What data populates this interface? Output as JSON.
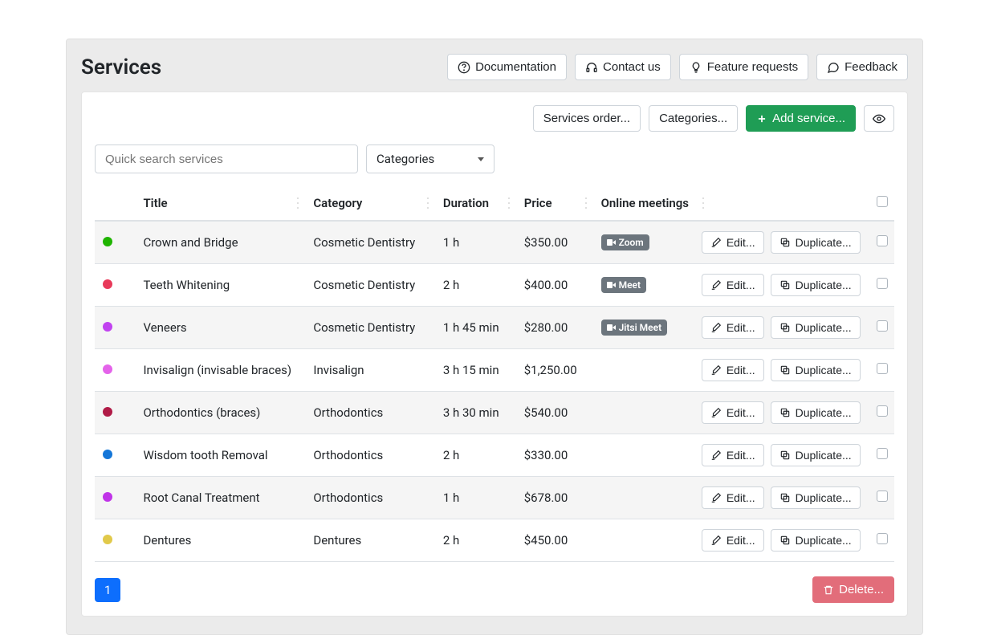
{
  "page": {
    "title": "Services"
  },
  "header_buttons": {
    "documentation": "Documentation",
    "contact": "Contact us",
    "feature_requests": "Feature requests",
    "feedback": "Feedback"
  },
  "top_actions": {
    "services_order": "Services order...",
    "categories": "Categories...",
    "add_service": "Add service..."
  },
  "filters": {
    "search_placeholder": "Quick search services",
    "categories_label": "Categories"
  },
  "columns": {
    "title": "Title",
    "category": "Category",
    "duration": "Duration",
    "price": "Price",
    "online": "Online meetings"
  },
  "row_buttons": {
    "edit": "Edit...",
    "duplicate": "Duplicate..."
  },
  "rows": [
    {
      "color": "#1fb400",
      "title": "Crown and Bridge",
      "category": "Cosmetic Dentistry",
      "duration": "1 h",
      "price": "$350.00",
      "online": "Zoom"
    },
    {
      "color": "#e83a5a",
      "title": "Teeth Whitening",
      "category": "Cosmetic Dentistry",
      "duration": "2 h",
      "price": "$400.00",
      "online": "Meet"
    },
    {
      "color": "#c142f0",
      "title": "Veneers",
      "category": "Cosmetic Dentistry",
      "duration": "1 h 45 min",
      "price": "$280.00",
      "online": "Jitsi Meet"
    },
    {
      "color": "#e463ea",
      "title": "Invisalign (invisable braces)",
      "category": "Invisalign",
      "duration": "3 h 15 min",
      "price": "$1,250.00",
      "online": ""
    },
    {
      "color": "#b01b47",
      "title": "Orthodontics (braces)",
      "category": "Orthodontics",
      "duration": "3 h 30 min",
      "price": "$540.00",
      "online": ""
    },
    {
      "color": "#1476d8",
      "title": "Wisdom tooth Removal",
      "category": "Orthodontics",
      "duration": "2 h",
      "price": "$330.00",
      "online": ""
    },
    {
      "color": "#c033e8",
      "title": "Root Canal Treatment",
      "category": "Orthodontics",
      "duration": "1 h",
      "price": "$678.00",
      "online": ""
    },
    {
      "color": "#e1c94a",
      "title": "Dentures",
      "category": "Dentures",
      "duration": "2 h",
      "price": "$450.00",
      "online": ""
    }
  ],
  "pagination": {
    "current": "1"
  },
  "bulk": {
    "delete": "Delete..."
  }
}
